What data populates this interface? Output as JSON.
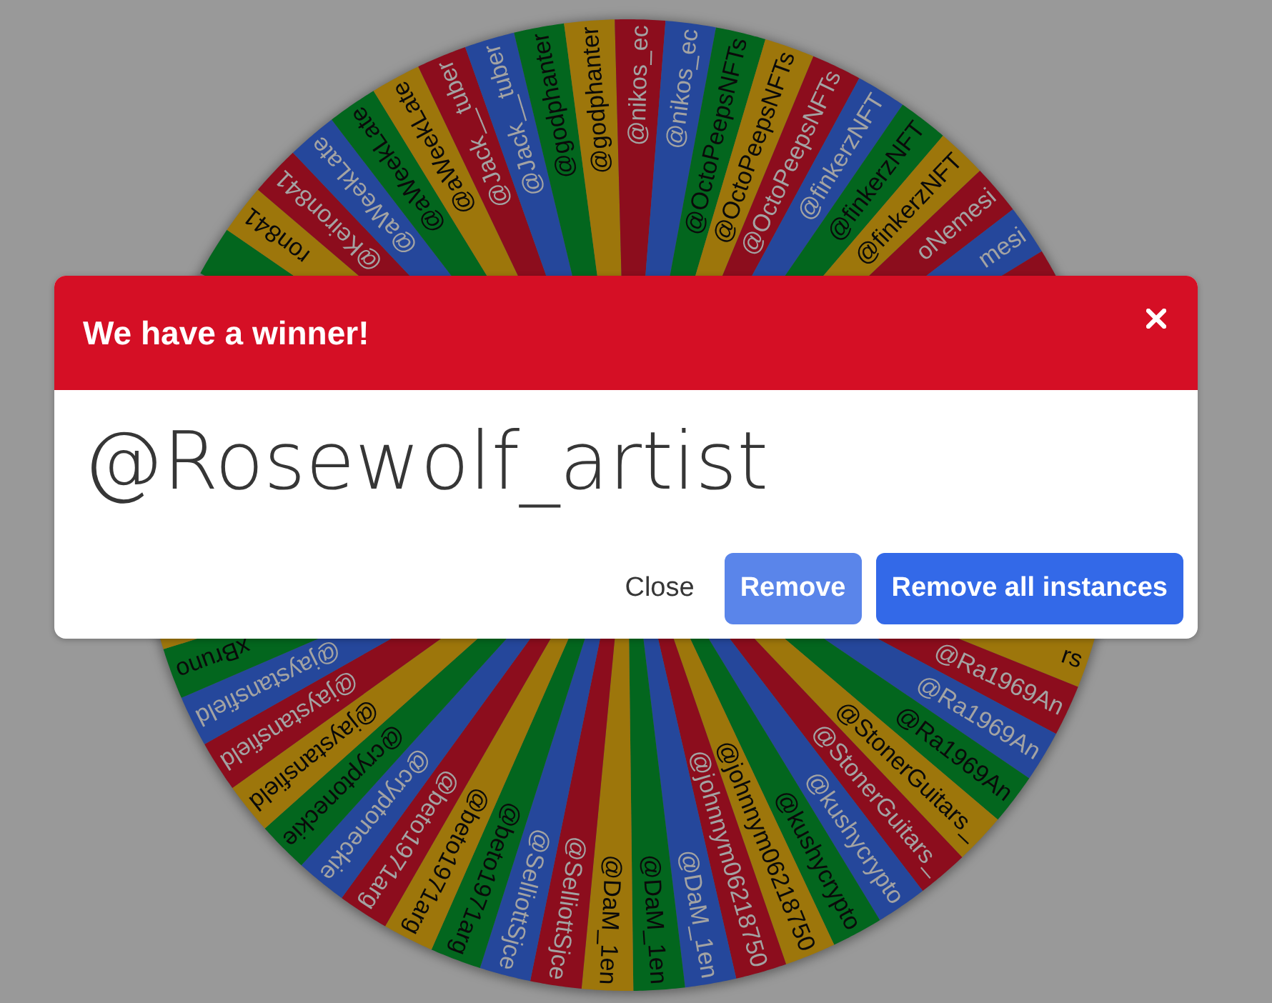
{
  "wheel": {
    "upper_slices": [
      {
        "color": "#03661e"
      },
      {
        "color": "#9d760b",
        "name": "ron841"
      },
      {
        "color": "#8c0d1d",
        "name": "@Keiron841"
      },
      {
        "color": "#25479b",
        "name": "@aWeekLate"
      },
      {
        "color": "#03661e",
        "name": "@aWeekLate"
      },
      {
        "color": "#9d760b",
        "name": "@aWeekLate"
      },
      {
        "color": "#8c0d1d",
        "name": "@Jack__tuber"
      },
      {
        "color": "#25479b",
        "name": "@Jack__tuber"
      },
      {
        "color": "#03661e",
        "name": "@godphanter"
      },
      {
        "color": "#9d760b",
        "name": "@godphanter"
      },
      {
        "color": "#8c0d1d",
        "name": "@nikos_ec"
      },
      {
        "color": "#25479b",
        "name": "@nikos_ec"
      },
      {
        "color": "#03661e",
        "name": "@OctoPeepsNFTs"
      },
      {
        "color": "#9d760b",
        "name": "@OctoPeepsNFTs"
      },
      {
        "color": "#8c0d1d",
        "name": "@OctoPeepsNFTs"
      },
      {
        "color": "#25479b",
        "name": "@finkerzNFT"
      },
      {
        "color": "#03661e",
        "name": "@finkerzNFT"
      },
      {
        "color": "#9d760b",
        "name": "@finkerzNFT"
      },
      {
        "color": "#8c0d1d",
        "name": "oNemesi"
      },
      {
        "color": "#25479b",
        "name": "mesi"
      },
      {
        "color": "#8c0d1d"
      }
    ],
    "lower_slices": [
      {
        "color": "#9d760b",
        "name": "rs"
      },
      {
        "color": "#8c0d1d",
        "name": "@Ra1969An"
      },
      {
        "color": "#25479b",
        "name": "@Ra1969An"
      },
      {
        "color": "#03661e",
        "name": "@Ra1969An"
      },
      {
        "color": "#9d760b",
        "name": "@StonerGuitars_"
      },
      {
        "color": "#8c0d1d",
        "name": "@StonerGuitars_"
      },
      {
        "color": "#25479b",
        "name": "@kushycrypto"
      },
      {
        "color": "#03661e",
        "name": "@kushycrypto"
      },
      {
        "color": "#9d760b",
        "name": "@johnnym06218750"
      },
      {
        "color": "#8c0d1d",
        "name": "@johnnym06218750"
      },
      {
        "color": "#25479b",
        "name": "@DaM_1en"
      },
      {
        "color": "#03661e",
        "name": "@DaM_1en"
      },
      {
        "color": "#9d760b",
        "name": "@DaM_1en"
      },
      {
        "color": "#8c0d1d",
        "name": "@SelliottSjce"
      },
      {
        "color": "#25479b",
        "name": "@SelliottSjce"
      },
      {
        "color": "#03661e",
        "name": "@beto1971arg"
      },
      {
        "color": "#9d760b",
        "name": "@beto1971arg"
      },
      {
        "color": "#8c0d1d",
        "name": "@beto1971arg"
      },
      {
        "color": "#25479b",
        "name": "@cryptoneckie"
      },
      {
        "color": "#03661e",
        "name": "@cryptoneckie"
      },
      {
        "color": "#9d760b",
        "name": "@jaystansfield"
      },
      {
        "color": "#8c0d1d",
        "name": "@jaystansfield"
      },
      {
        "color": "#25479b",
        "name": "@jaystansfield"
      },
      {
        "color": "#03661e",
        "name": "xBruno"
      },
      {
        "color": "#9d760b"
      }
    ]
  },
  "dialog": {
    "title": "We have a winner!",
    "winner": "@Rosewolf_artist",
    "buttons": [
      {
        "label": "Close",
        "kind": "text"
      },
      {
        "label": "Remove",
        "kind": "secondary"
      },
      {
        "label": "Remove all instances",
        "kind": "primary"
      }
    ]
  }
}
